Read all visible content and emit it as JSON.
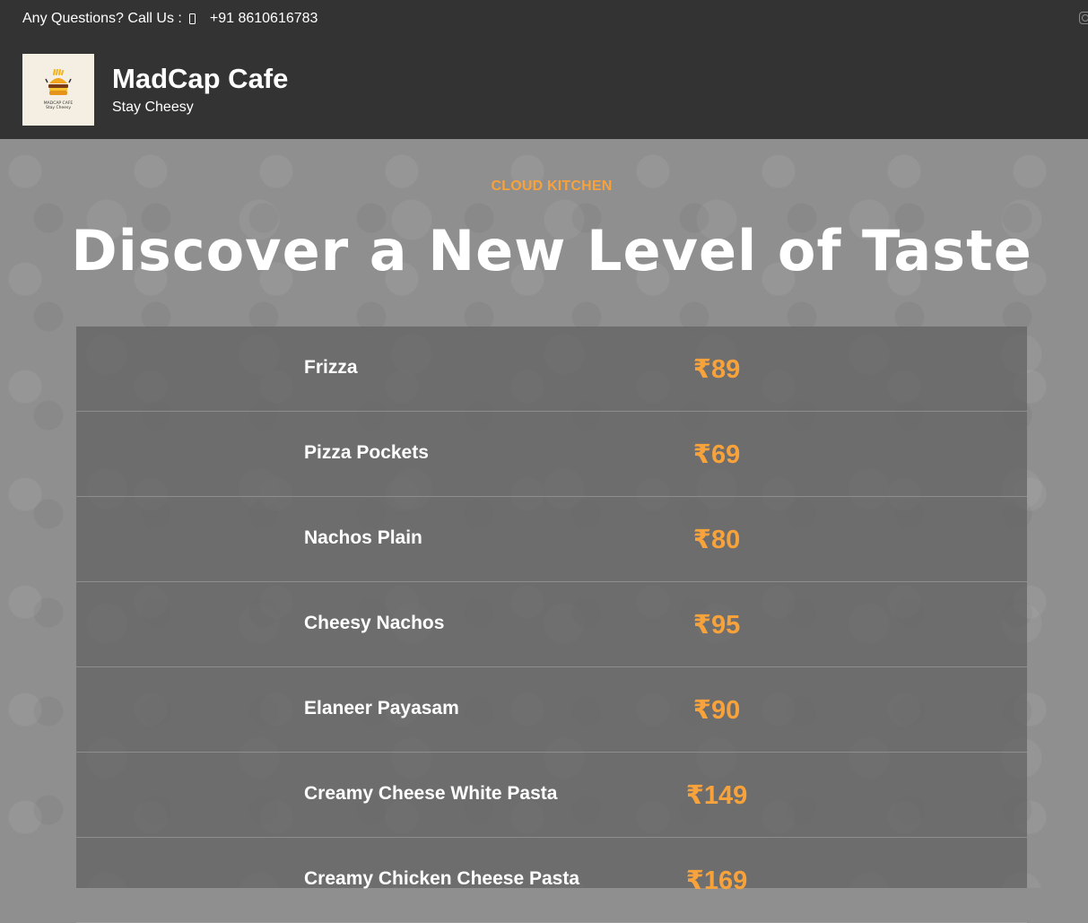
{
  "header": {
    "contact_prompt": "Any Questions? Call Us :",
    "phone": "+91 8610616783",
    "brand_name": "MadCap Cafe",
    "tagline": "Stay Cheesy",
    "logo_text_line1": "MADCAP CAFE",
    "logo_text_line2": "Stay Cheesy"
  },
  "hero": {
    "eyebrow": "CLOUD KITCHEN",
    "title": "Discover a New Level of Taste"
  },
  "menu": {
    "items": [
      {
        "name": "Frizza",
        "price": "₹89"
      },
      {
        "name": "Pizza Pockets",
        "price": "₹69"
      },
      {
        "name": "Nachos Plain",
        "price": "₹80"
      },
      {
        "name": "Cheesy Nachos",
        "price": "₹95"
      },
      {
        "name": "Elaneer Payasam",
        "price": "₹90"
      },
      {
        "name": "Creamy Cheese White Pasta",
        "price": "₹149"
      },
      {
        "name": "Creamy Chicken Cheese Pasta",
        "price": "₹169"
      }
    ]
  },
  "colors": {
    "header_bg": "#333333",
    "accent": "#f7a23b",
    "page_bg": "#8f8f8f"
  },
  "icons": [
    "mobile-phone-icon",
    "instagram-icon"
  ]
}
